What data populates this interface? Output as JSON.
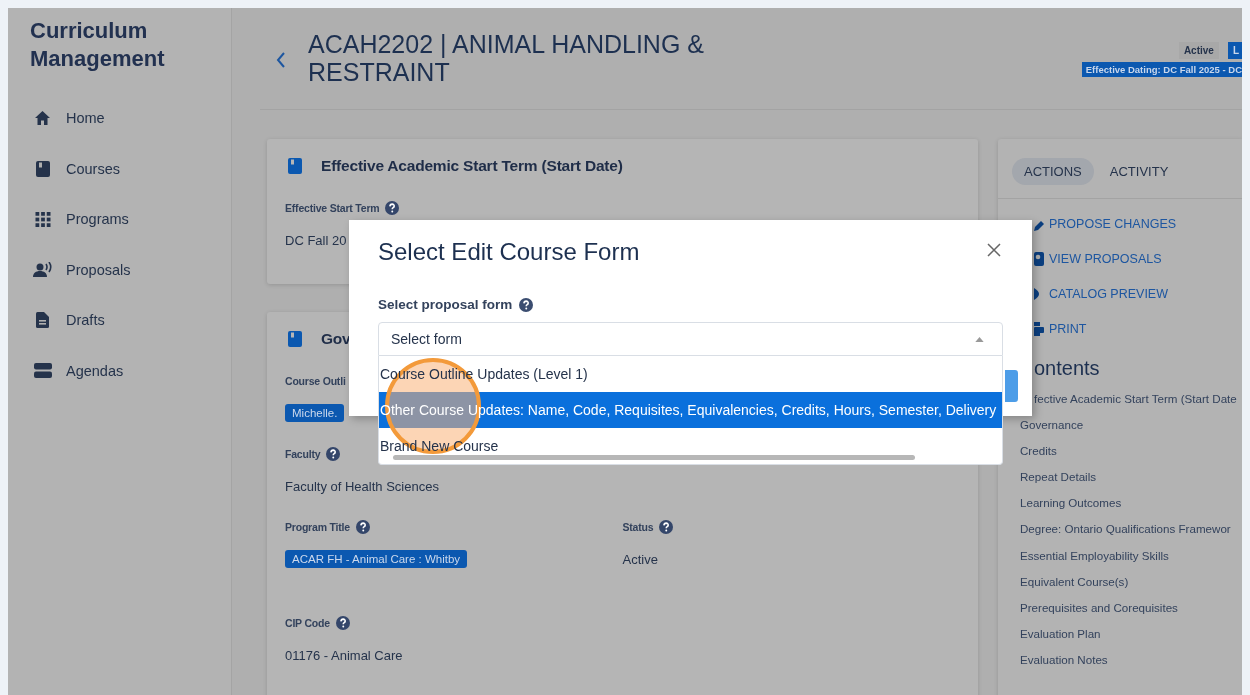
{
  "sidebar": {
    "title": "Curriculum Management",
    "items": [
      {
        "label": "Home"
      },
      {
        "label": "Courses"
      },
      {
        "label": "Programs"
      },
      {
        "label": "Proposals"
      },
      {
        "label": "Drafts"
      },
      {
        "label": "Agendas"
      }
    ]
  },
  "header": {
    "title": "ACAH2202 | ANIMAL HANDLING & RESTRAINT",
    "status_badge": "Active",
    "badge_2": "L",
    "dating_badge": "Effective Dating: DC Fall 2025 - DC"
  },
  "cards": [
    {
      "title": "Effective Academic Start Term (Start Date)",
      "rows": [
        [
          {
            "label": "Effective Start Term",
            "help": true,
            "kind": "text",
            "value": "DC Fall 20"
          }
        ]
      ]
    },
    {
      "title": "Gov",
      "rows": [
        [
          {
            "label": "Course Outli",
            "help": false,
            "kind": "chip",
            "value": "Michelle."
          }
        ],
        [
          {
            "label": "Faculty",
            "help": true,
            "kind": "text",
            "value": "Faculty of Health Sciences"
          }
        ],
        [
          {
            "label": "Program Title",
            "help": true,
            "kind": "chip",
            "value": "ACAR FH - Animal Care : Whitby"
          },
          {
            "label": "Status",
            "help": true,
            "kind": "text",
            "value": "Active"
          }
        ],
        [
          {
            "label": "CIP Code",
            "help": true,
            "kind": "text",
            "value": "01176 - Animal Care"
          }
        ]
      ]
    }
  ],
  "side_panel": {
    "tabs": [
      {
        "label": "ACTIONS",
        "selected": true
      },
      {
        "label": "ACTIVITY",
        "selected": false
      }
    ],
    "actions": [
      "PROPOSE CHANGES",
      "VIEW PROPOSALS",
      "CATALOG PREVIEW",
      "PRINT"
    ],
    "contents_title": "ontents",
    "contents": [
      "fective Academic Start Term (Start Date",
      "Governance",
      "Credits",
      "Repeat Details",
      "Learning Outcomes",
      "Degree: Ontario Qualifications Framewor",
      "Essential Employability Skills",
      "Equivalent Course(s)",
      "Prerequisites and Corequisites",
      "Evaluation Plan",
      "Evaluation Notes"
    ]
  },
  "modal": {
    "title": "Select Edit Course Form",
    "field_label": "Select proposal form",
    "field_help": true,
    "placeholder": "Select form",
    "expanded": true,
    "options": [
      {
        "label": "Course Outline Updates (Level 1)",
        "selected": false
      },
      {
        "label": "Other Course Updates: Name, Code, Requisites, Equivalencies, Credits, Hours, Semester, Delivery",
        "selected": true
      },
      {
        "label": "Brand New Course",
        "selected": false
      }
    ]
  }
}
